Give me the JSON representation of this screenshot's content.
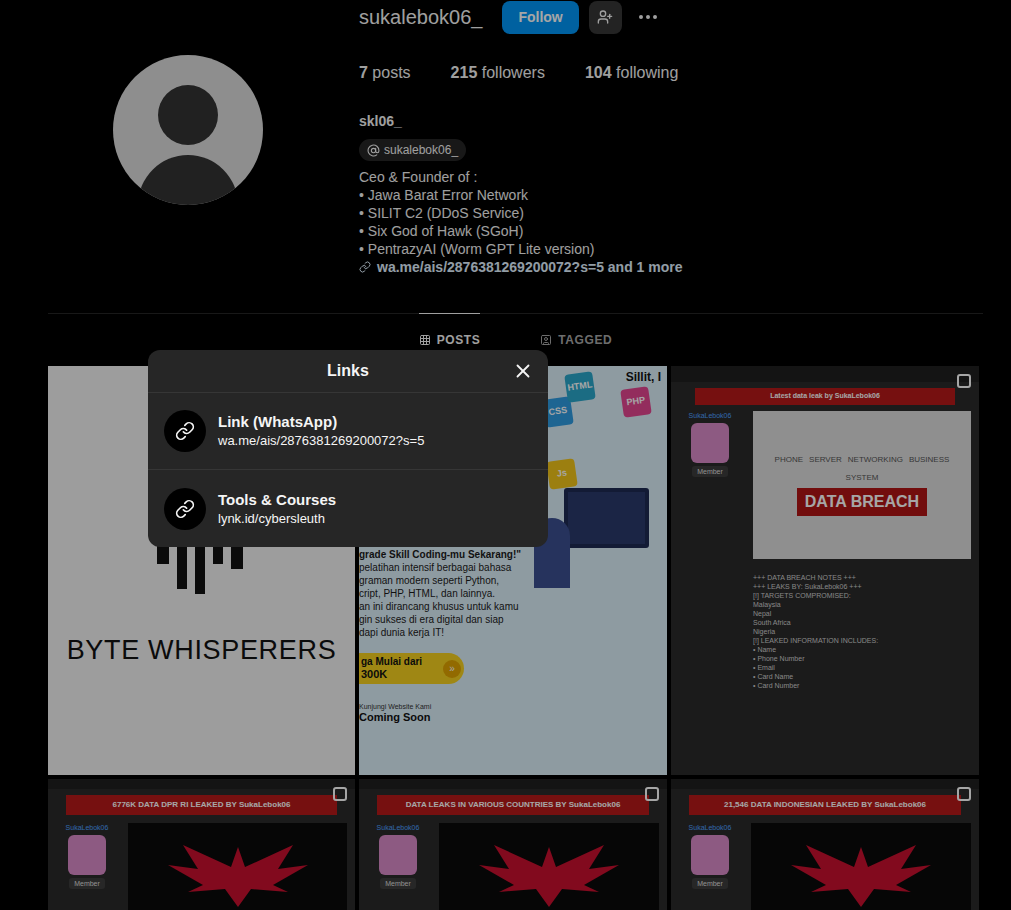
{
  "profile": {
    "username": "sukalebok06_",
    "follow_button": "Follow",
    "stats": [
      {
        "value": "7",
        "label": "posts"
      },
      {
        "value": "215",
        "label": "followers"
      },
      {
        "value": "104",
        "label": "following"
      }
    ],
    "name": "skl06_",
    "threads_badge": "sukalebok06_",
    "bio": [
      "Ceo & Founder of :",
      "• Jawa Barat Error Network",
      "• SILIT C2 (DDoS Service)",
      "• Six God of Hawk (SGoH)",
      "• PentrazyAI (Worm GPT Lite version)"
    ],
    "link": "wa.me/ais/2876381269200072?s=5 and 1 more"
  },
  "tabs": [
    {
      "label": "POSTS",
      "selected": true
    },
    {
      "label": "TAGGED",
      "selected": false
    }
  ],
  "posts": [
    {
      "kind": "logo",
      "text": "BYTE WHISPERERS"
    },
    {
      "kind": "promo",
      "corner": "Sillit, I",
      "lines": [
        "grade Skill Coding-mu Sekarang!\"",
        "pelatihan intensif berbagai bahasa",
        "graman modern seperti Python,",
        "cript, PHP, HTML, dan lainnya.",
        "an ini dirancang khusus untuk kamu",
        "gin sukses di era digital dan siap",
        "dapi dunia kerja IT!"
      ],
      "price_label": "ga Mulai dari",
      "price": "300K",
      "website_label": "Kunjungi Website Kami",
      "website_status": "Coming Soon",
      "tags": [
        "CSS",
        "HTML",
        "Js",
        "PHP"
      ]
    },
    {
      "kind": "leak-note",
      "banner": "Latest data leak by SukaLebok06",
      "user": "SukaLebok06",
      "badge": "Member",
      "image_text": "DATA BREACH",
      "words": [
        "PHONE",
        "SERVER",
        "NETWORKING",
        "BUSINESS",
        "SYSTEM"
      ],
      "lines": [
        "+++ DATA BREACH NOTES +++",
        "+++ LEAKS BY: SukaLebok06 +++",
        "[!] TARGETS COMPROMISED:",
        "Malaysia",
        "Nepal",
        "South Africa",
        "Nigeria",
        "[!] LEAKED INFORMATION INCLUDES:",
        "• Name",
        "• Phone Number",
        "• Email",
        "• Card Name",
        "• Card Number"
      ]
    },
    {
      "kind": "leak-banner",
      "banner": "6776K DATA DPR RI LEAKED BY SukaLebok06",
      "user": "SukaLebok06",
      "badge": "Member"
    },
    {
      "kind": "leak-banner",
      "banner": "DATA LEAKS IN VARIOUS COUNTRIES BY SukaLebok06",
      "user": "SukaLebok06",
      "badge": "Member"
    },
    {
      "kind": "leak-banner",
      "banner": "21,546 DATA INDONESIAN LEAKED BY SukaLebok06",
      "user": "SukaLebok06",
      "badge": "Member"
    }
  ],
  "links_dialog": {
    "open": true,
    "title": "Links",
    "items": [
      {
        "title": "Link (WhatsApp)",
        "url": "wa.me/ais/2876381269200072?s=5"
      },
      {
        "title": "Tools & Courses",
        "url": "lynk.id/cybersleuth"
      }
    ]
  }
}
